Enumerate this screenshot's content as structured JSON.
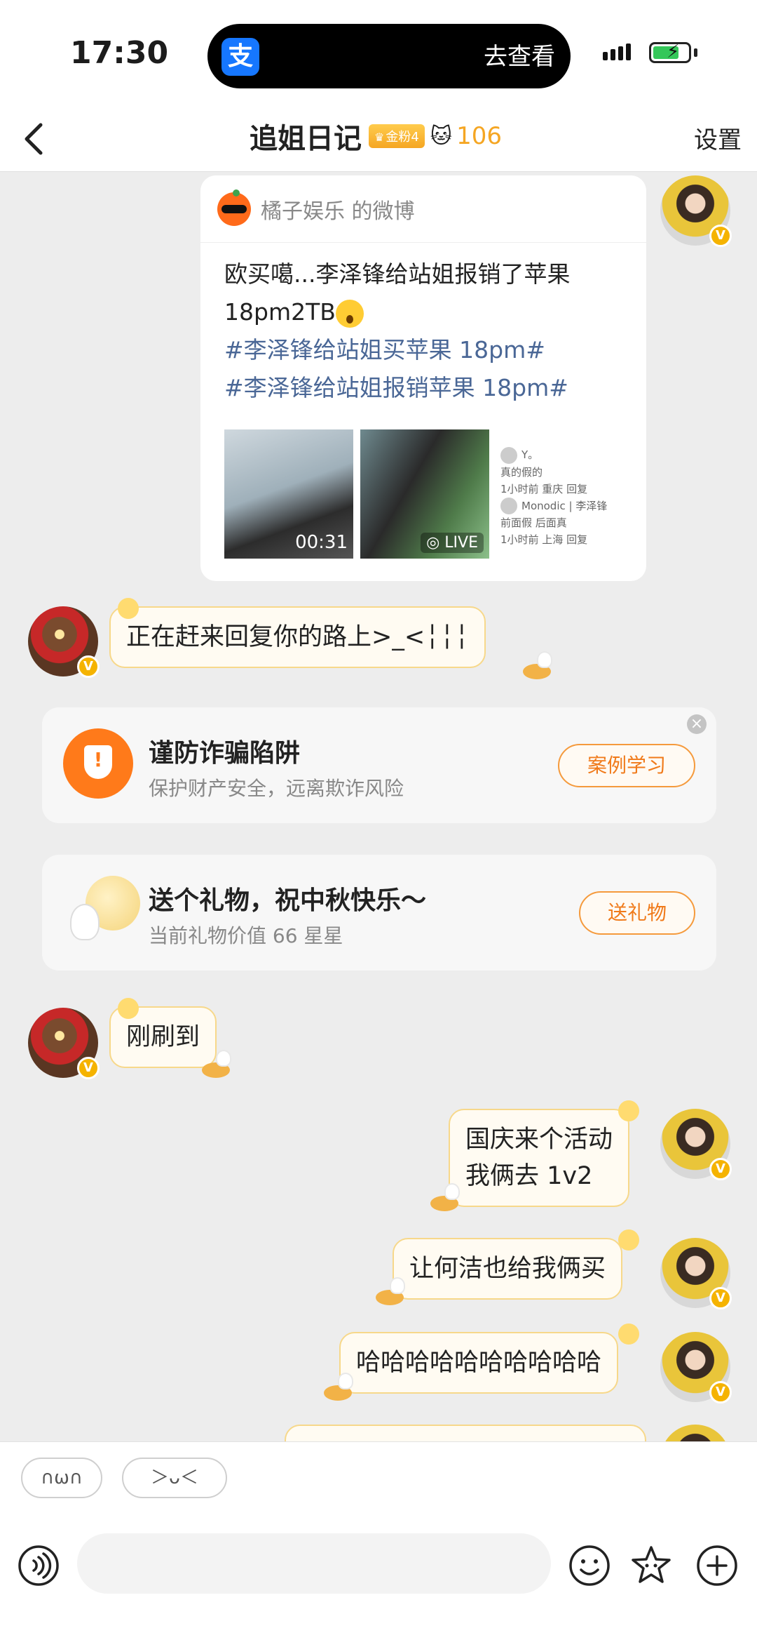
{
  "status_bar": {
    "time": "17:30",
    "island_action": "去查看",
    "app_glyph": "支"
  },
  "header": {
    "title": "追姐日记",
    "fan_badge": "金粉4",
    "fan_count": "106",
    "settings_label": "设置"
  },
  "share_card": {
    "source": "橘子娱乐 的微博",
    "text_line1": "欧买噶...李泽锋给站姐报销了苹果",
    "text_line2": "18pm2TB",
    "hashtag1": "#李泽锋给站姐买苹果 18pm#",
    "hashtag2": "#李泽锋给站姐报销苹果 18pm#",
    "video_duration": "00:31",
    "live_label": "LIVE",
    "comment1_user": "Y。",
    "comment1_text": "真的假的",
    "comment1_meta": "1小时前 重庆 回复",
    "comment2_user": "Monodic | 李泽锋",
    "comment2_text": "前面假 后面真",
    "comment2_meta": "1小时前 上海 回复"
  },
  "messages": [
    {
      "side": "left",
      "text": "正在赶来回复你的路上>_<╎╎╎"
    },
    {
      "side": "left",
      "text": "刚刷到"
    },
    {
      "side": "right",
      "line1": "国庆来个活动",
      "line2": "我俩去 1v2"
    },
    {
      "side": "right",
      "text": "让何洁也给我俩买"
    },
    {
      "side": "right",
      "text": "哈哈哈哈哈哈哈哈哈哈"
    }
  ],
  "fraud_card": {
    "title": "谨防诈骗陷阱",
    "subtitle": "保护财产安全，远离欺诈风险",
    "button": "案例学习"
  },
  "gift_card": {
    "title": "送个礼物，祝中秋快乐～",
    "subtitle": "当前礼物价值 66 星星",
    "button": "送礼物"
  },
  "bottom_bar": {
    "chip1": "∩ω∩",
    "chip2": "＞ᴗ＜",
    "input_placeholder": ""
  },
  "icons": [
    "back-icon",
    "verified-icon",
    "shield-icon",
    "close-icon",
    "moon-icon",
    "voice-icon",
    "emoji-icon",
    "sticker-icon",
    "plus-icon"
  ]
}
